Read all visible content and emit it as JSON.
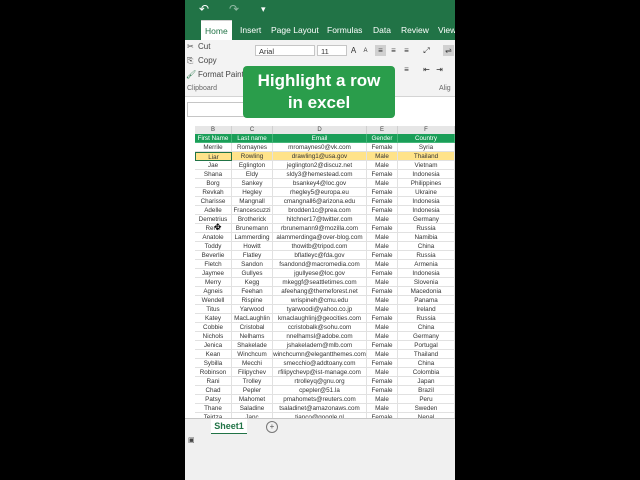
{
  "qat": {
    "undo": "↶",
    "redo": "↷",
    "more": "▾"
  },
  "tabs": [
    "Home",
    "Insert",
    "Page Layout",
    "Formulas",
    "Data",
    "Review",
    "View"
  ],
  "ribbon": {
    "cut": "Cut",
    "copy": "Copy",
    "format_painter": "Format Paint",
    "clipboard": "Clipboard",
    "font": "Arial",
    "size": "11",
    "align_group": "Alig"
  },
  "banner": {
    "line1": "Highlight a row",
    "line2": "in excel"
  },
  "columns": [
    "B",
    "C",
    "D",
    "E",
    "F"
  ],
  "headers": [
    "First Name",
    "Last name",
    "Email",
    "Gender",
    "Country"
  ],
  "rows": [
    [
      "Merrile",
      "Romaynes",
      "mromaynes0@vk.com",
      "Female",
      "Syria"
    ],
    [
      "Liar",
      "Rowling",
      "drawling1@usa.gov",
      "Male",
      "Thailand"
    ],
    [
      "Jae",
      "Eglington",
      "jeglington2@discuz.net",
      "Male",
      "Vietnam"
    ],
    [
      "Shana",
      "Eldy",
      "sldy3@hemestead.com",
      "Female",
      "Indonesia"
    ],
    [
      "Borg",
      "Sankey",
      "bsankey4@loc.gov",
      "Male",
      "Philippines"
    ],
    [
      "Revkah",
      "Hegley",
      "rhegley5@europa.eu",
      "Female",
      "Ukraine"
    ],
    [
      "Charisse",
      "Mangnall",
      "cmangnall6@arizona.edu",
      "Female",
      "Indonesia"
    ],
    [
      "Adelle",
      "Francescuzzi",
      "brodden1c@prea.com",
      "Female",
      "Indonesia"
    ],
    [
      "Demetrius",
      "Brotherick",
      "hitchner17@twitter.com",
      "Male",
      "Germany"
    ],
    [
      "Renn",
      "Brunemann",
      "rbrunemann9@mozilla.com",
      "Female",
      "Russia"
    ],
    [
      "Anatole",
      "Lammerding",
      "alammerdinga@over-blog.com",
      "Male",
      "Namibia"
    ],
    [
      "Toddy",
      "Howitt",
      "thowitb@tripod.com",
      "Male",
      "China"
    ],
    [
      "Beverlie",
      "Flatley",
      "bflatleyc@fda.gov",
      "Female",
      "Russia"
    ],
    [
      "Fletch",
      "Sandon",
      "fsandond@macromedia.com",
      "Male",
      "Armenia"
    ],
    [
      "Jaymee",
      "Gullyes",
      "jgullyese@loc.gov",
      "Female",
      "Indonesia"
    ],
    [
      "Merry",
      "Kegg",
      "mkeggf@seattletimes.com",
      "Male",
      "Slovenia"
    ],
    [
      "Agneis",
      "Feehan",
      "afeehang@themeforest.net",
      "Female",
      "Macedonia"
    ],
    [
      "Wendell",
      "Rispine",
      "wrispineh@cmu.edu",
      "Male",
      "Panama"
    ],
    [
      "Titus",
      "Yarwood",
      "tyarwoodi@yahoo.co.jp",
      "Male",
      "Ireland"
    ],
    [
      "Katey",
      "MacLaughlin",
      "kmaclaughlinj@geocities.com",
      "Female",
      "Russia"
    ],
    [
      "Cobbie",
      "Cristobal",
      "ccristobalk@sohu.com",
      "Male",
      "China"
    ],
    [
      "Nichols",
      "Nelhams",
      "nnelhamsl@adobe.com",
      "Male",
      "Germany"
    ],
    [
      "Jenica",
      "Shakelade",
      "jshakeladem@mlb.com",
      "Female",
      "Portugal"
    ],
    [
      "Kean",
      "Winchcum",
      "winchcumn@elegantthemes.com",
      "Male",
      "Thailand"
    ],
    [
      "Sybilla",
      "Mecchi",
      "smecchio@addtoany.com",
      "Female",
      "China"
    ],
    [
      "Robinson",
      "Filipychev",
      "rfilipychevp@ist-manage.com",
      "Male",
      "Colombia"
    ],
    [
      "Rani",
      "Trolley",
      "rtrolleyq@gnu.org",
      "Female",
      "Japan"
    ],
    [
      "Chad",
      "Pepler",
      "cpepler@51.la",
      "Female",
      "Brazil"
    ],
    [
      "Patsy",
      "Mahomet",
      "pmahomets@reuters.com",
      "Male",
      "Peru"
    ],
    [
      "Thane",
      "Saladine",
      "tsaladinet@amazonaws.com",
      "Male",
      "Sweden"
    ],
    [
      "Teirtza",
      "Janc",
      "tjanco@google.nl",
      "Female",
      "Nepal"
    ]
  ],
  "highlight_row": 1,
  "sheet": {
    "name": "Sheet1",
    "add": "+"
  },
  "colors": {
    "brand": "#217346",
    "header_fill": "#1a9e58",
    "highlight": "#ffe38a",
    "banner": "#2a9d4b"
  }
}
